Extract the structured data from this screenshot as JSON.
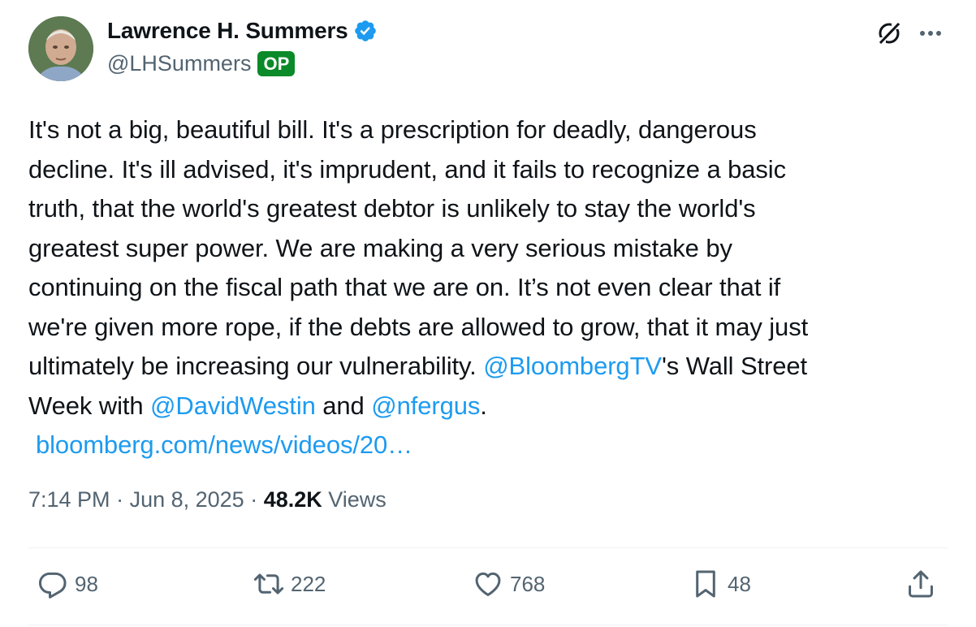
{
  "author": {
    "display_name": "Lawrence H. Summers",
    "handle": "@LHSummers",
    "badge": "OP",
    "verified_color": "#1d9bf0",
    "badge_color": "#0a8a28"
  },
  "tweet": {
    "lines": [
      "It's not a big, beautiful bill. It's a prescription for deadly, dangerous",
      "decline. It's ill advised, it's imprudent, and it fails to recognize a basic",
      "truth, that the world's greatest debtor is unlikely to stay the world's",
      "greatest super power. We are making a very serious mistake by",
      "continuing on the fiscal path that we are on. It’s not even clear that if",
      "we're given more rope, if the debts are allowed to grow, that it may just"
    ],
    "line7_text": "ultimately be increasing our vulnerability. ",
    "mention_bloomberg": "@BloombergTV",
    "line7_after": "'s Wall Street",
    "line8_before": "Week with ",
    "mention_westin": "@DavidWestin",
    "line8_and": " and ",
    "mention_nfergus": "@nfergus",
    "line8_end": ".",
    "link": "bloomberg.com/news/videos/20…",
    "link_color": "#1d9bf0"
  },
  "meta": {
    "time": "7:14 PM",
    "sep1": " · ",
    "date": "Jun 8, 2025",
    "sep2": " · ",
    "views_count": "48.2K",
    "views_label": " Views"
  },
  "actions": {
    "replies": "98",
    "reposts": "222",
    "likes": "768",
    "bookmarks": "48"
  },
  "icons": {
    "verified": "verified-badge-icon",
    "grok": "grok-icon",
    "more": "more-options-icon",
    "reply": "reply-icon",
    "repost": "repost-icon",
    "like": "heart-icon",
    "bookmark": "bookmark-icon",
    "share": "share-icon"
  }
}
